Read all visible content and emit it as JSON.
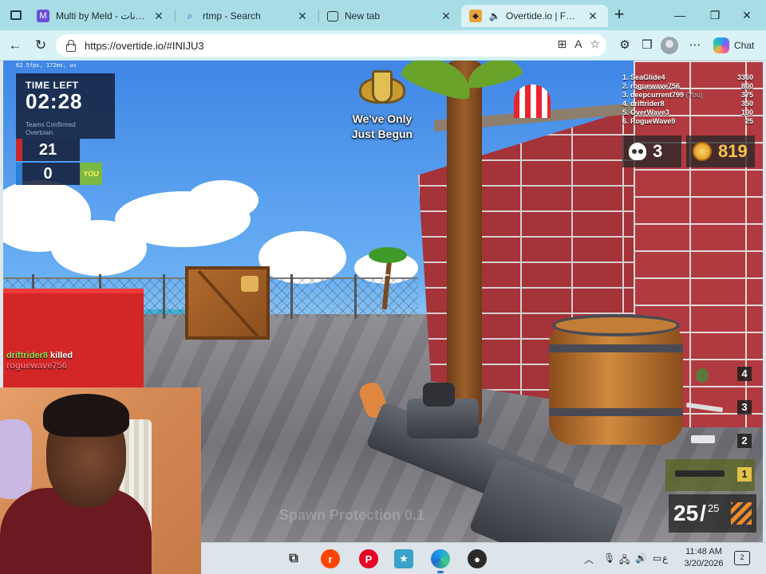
{
  "browser": {
    "tabs": [
      {
        "title": "Multi by Meld - جة بيانات",
        "favicon": "meld-icon",
        "active": false
      },
      {
        "title": "rtmp - Search",
        "favicon": "search-icon",
        "active": false
      },
      {
        "title": "New tab",
        "favicon": "newtab-icon",
        "active": false
      },
      {
        "title": "Overtide.io | FPS io G",
        "favicon": "overtide-icon",
        "active": true,
        "audio": "speaker-icon"
      }
    ],
    "url": "https://overtide.io/#INIJU3",
    "chat_label": "Chat"
  },
  "game": {
    "fps_text": "62.5fps, 172ms, us",
    "time_left_label": "TIME LEFT",
    "time_left": "02:28",
    "mode_line1": "Teams Confirmed",
    "mode_line2": "Overtown",
    "team_scores": [
      {
        "value": "21",
        "color": "#c62828"
      },
      {
        "value": "0",
        "color": "#2a7fd4"
      }
    ],
    "you_label": "YOU",
    "notice_line1": "We've Only",
    "notice_line2": "Just Begun",
    "leaderboard": [
      {
        "rank": "1.",
        "name": "SeaGlide4",
        "you": "",
        "points": "3360"
      },
      {
        "rank": "2.",
        "name": "roguewave756",
        "you": "",
        "points": "800"
      },
      {
        "rank": "3.",
        "name": "deepcurrent799",
        "you": "(You)",
        "points": "375"
      },
      {
        "rank": "4.",
        "name": "driftrider8",
        "you": "",
        "points": "350"
      },
      {
        "rank": "5.",
        "name": "OverWave3",
        "you": "",
        "points": "100"
      },
      {
        "rank": "6.",
        "name": "RogueWave9",
        "you": "",
        "points": "25"
      }
    ],
    "kills": "3",
    "coins": "819",
    "killfeed": {
      "killer": "driftrider8",
      "action": "killed",
      "victim": "roguewave756"
    },
    "weapon_slots": [
      {
        "num": "4",
        "icon": "grenade-icon",
        "active": false
      },
      {
        "num": "3",
        "icon": "knife-icon",
        "active": false
      },
      {
        "num": "2",
        "icon": "pistol-icon",
        "active": false
      },
      {
        "num": "1",
        "icon": "rifle-icon",
        "active": true
      }
    ],
    "ammo_current": "25",
    "ammo_max": "25",
    "spawn_protection": "Spawn Protection 0.1"
  },
  "taskbar": {
    "apps": [
      "task-view-icon",
      "reddit-icon",
      "pinterest-icon",
      "game-icon",
      "edge-icon",
      "obs-icon"
    ],
    "tray_lang": "ع",
    "time": "11:48 AM",
    "date": "3/20/2026",
    "notifications": "2"
  }
}
